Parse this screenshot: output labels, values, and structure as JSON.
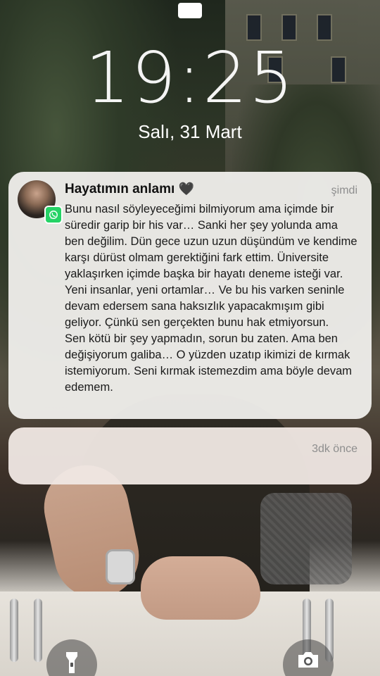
{
  "lockscreen": {
    "time": "19:25",
    "date": "Salı, 31 Mart"
  },
  "notifications": [
    {
      "app": "whatsapp",
      "app_icon": "whatsapp-icon",
      "sender": "Hayatımın anlamı",
      "sender_emoji": "🖤",
      "timestamp": "şimdi",
      "message": "Bunu nasıl söyleyeceğimi bilmiyorum ama içimde bir süredir garip bir his var… Sanki her şey yolunda ama ben değilim. Dün gece uzun uzun düşündüm ve kendime karşı dürüst olmam gerektiğini fark ettim. Üniversite yaklaşırken içimde başka bir hayatı deneme isteği var. Yeni insanlar, yeni ortamlar… Ve bu his varken seninle devam edersem sana haksızlık yapacakmışım gibi geliyor. Çünkü sen gerçekten bunu hak etmiyorsun.\nSen kötü bir şey yapmadın, sorun bu zaten. Ama ben değişiyorum galiba… O yüzden uzatıp ikimizi de kırmak istemiyorum. Seni kırmak istemezdim ama böyle devam edemem."
    },
    {
      "timestamp": "3dk önce"
    }
  ],
  "quick_actions": {
    "left_icon": "flashlight-icon",
    "right_icon": "camera-icon"
  },
  "colors": {
    "notification_bg": "#eeedea",
    "whatsapp_green": "#25d366",
    "timestamp_gray": "#8e8e8e"
  }
}
